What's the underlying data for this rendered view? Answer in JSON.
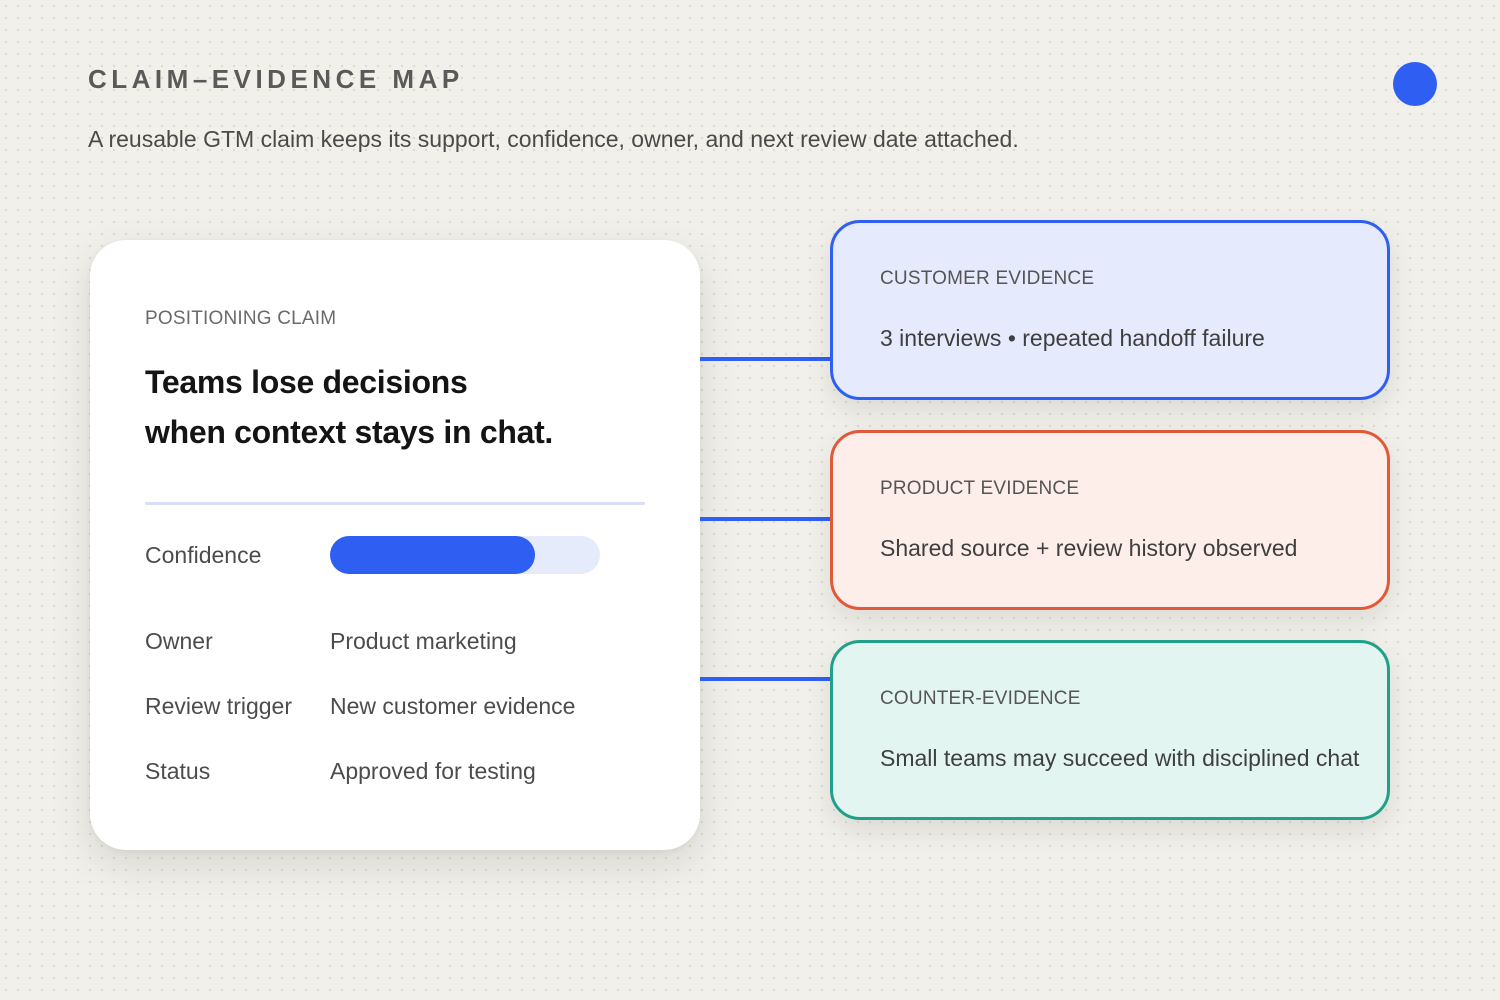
{
  "header": {
    "title": "CLAIM–EVIDENCE MAP",
    "subtitle": "A reusable GTM claim keeps its support, confidence, owner, and next review date attached."
  },
  "claim": {
    "eyebrow": "POSITIONING CLAIM",
    "text_line1": "Teams lose decisions",
    "text_line2": "when context stays in chat.",
    "confidence_label": "Confidence",
    "confidence_level": 0.76,
    "fields": [
      {
        "label": "Owner",
        "value": "Product marketing"
      },
      {
        "label": "Review trigger",
        "value": "New customer evidence"
      },
      {
        "label": "Status",
        "value": "Approved for testing"
      }
    ]
  },
  "evidence": [
    {
      "title": "CUSTOMER EVIDENCE",
      "text": "3 interviews • repeated handoff failure"
    },
    {
      "title": "PRODUCT EVIDENCE",
      "text": "Shared source + review history observed"
    },
    {
      "title": "COUNTER-EVIDENCE",
      "text": "Small teams may succeed with disciplined chat"
    }
  ],
  "colors": {
    "accent": "#2f5ff2",
    "customer": "#2f5ff2",
    "product": "#e0593a",
    "counter": "#20a08a"
  }
}
